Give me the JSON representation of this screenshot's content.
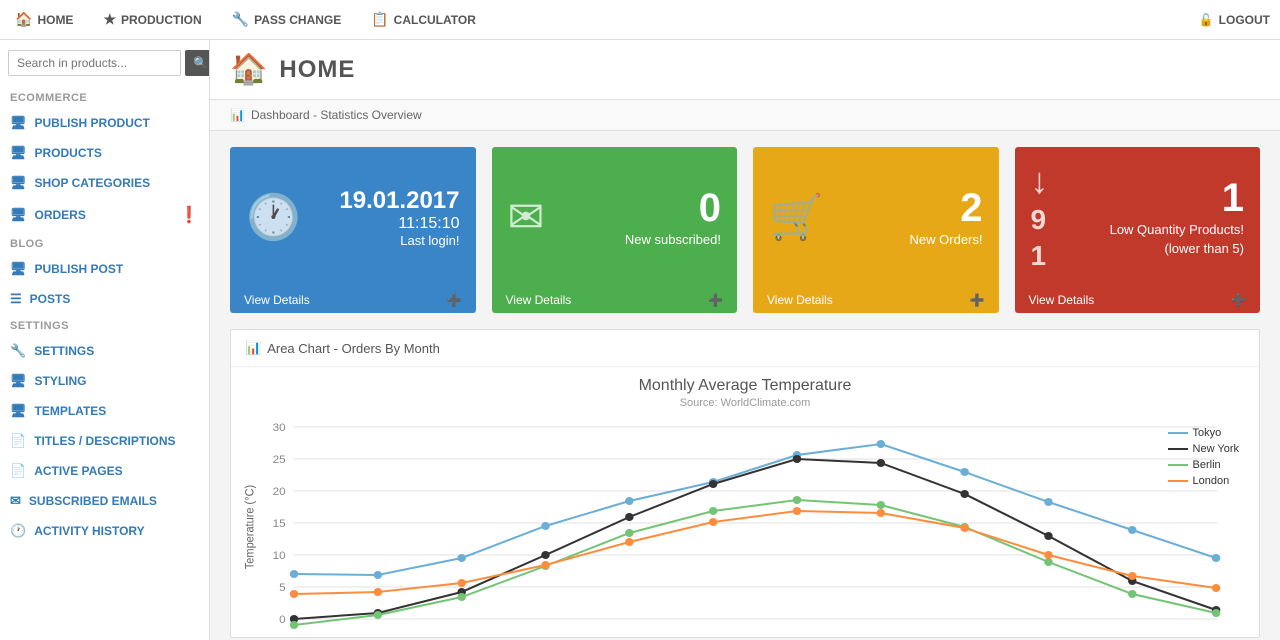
{
  "topnav": {
    "items": [
      {
        "label": "HOME",
        "icon": "🏠",
        "name": "home"
      },
      {
        "label": "PRODUCTION",
        "icon": "★",
        "name": "production"
      },
      {
        "label": "PASS CHANGE",
        "icon": "🔧",
        "name": "pass-change"
      },
      {
        "label": "CALCULATOR",
        "icon": "📋",
        "name": "calculator"
      }
    ],
    "logout_label": "LOGOUT",
    "logout_icon": "🔓"
  },
  "sidebar": {
    "search_placeholder": "Search in products...",
    "sections": [
      {
        "label": "ECOMMERCE",
        "items": [
          {
            "label": "PUBLISH PRODUCT",
            "icon": "🖥",
            "name": "publish-product",
            "alert": false
          },
          {
            "label": "PRODUCTS",
            "icon": "🖥",
            "name": "products",
            "alert": false
          },
          {
            "label": "SHOP CATEGORIES",
            "icon": "🖥",
            "name": "shop-categories",
            "alert": false
          },
          {
            "label": "ORDERS",
            "icon": "🖥",
            "name": "orders",
            "alert": true
          }
        ]
      },
      {
        "label": "BLOG",
        "items": [
          {
            "label": "PUBLISH POST",
            "icon": "🖥",
            "name": "publish-post",
            "alert": false
          },
          {
            "label": "POSTS",
            "icon": "☰",
            "name": "posts",
            "alert": false
          }
        ]
      },
      {
        "label": "SETTINGS",
        "items": [
          {
            "label": "SETTINGS",
            "icon": "🔧",
            "name": "settings",
            "alert": false
          },
          {
            "label": "STYLING",
            "icon": "🖥",
            "name": "styling",
            "alert": false
          },
          {
            "label": "TEMPLATES",
            "icon": "🖥",
            "name": "templates",
            "alert": false
          },
          {
            "label": "TITLES / DESCRIPTIONS",
            "icon": "📄",
            "name": "titles-descriptions",
            "alert": false
          },
          {
            "label": "ACTIVE PAGES",
            "icon": "📄",
            "name": "active-pages",
            "alert": false
          },
          {
            "label": "SUBSCRIBED EMAILS",
            "icon": "✉",
            "name": "subscribed-emails",
            "alert": false
          },
          {
            "label": "ACTIVITY HISTORY",
            "icon": "🕐",
            "name": "activity-history",
            "alert": false
          }
        ]
      }
    ]
  },
  "main": {
    "title": "HOME",
    "breadcrumb": "Dashboard - Statistics Overview",
    "stats": [
      {
        "type": "datetime",
        "color": "card-blue",
        "date": "19.01.2017",
        "time": "11:15:10",
        "sublabel": "Last login!",
        "footer_label": "View Details",
        "icon": "🕐"
      },
      {
        "type": "number",
        "color": "card-green",
        "number": "0",
        "label": "New subscribed!",
        "footer_label": "View Details",
        "icon": "✉"
      },
      {
        "type": "number",
        "color": "card-orange",
        "number": "2",
        "label": "New Orders!",
        "footer_label": "View Details",
        "icon": "🛒"
      },
      {
        "type": "low-qty",
        "color": "card-red",
        "number": "1",
        "label": "Low Quantity Products!",
        "sublabel": "(lower than 5)",
        "footer_label": "View Details",
        "icon": "↓91"
      }
    ],
    "chart": {
      "header": "Area Chart - Orders By Month",
      "title": "Monthly Average Temperature",
      "subtitle": "Source: WorldClimate.com",
      "y_label": "Temperature (°C)",
      "y_axis": [
        0,
        5,
        10,
        15,
        20,
        25,
        30
      ],
      "series": [
        {
          "name": "Tokyo",
          "color": "#6baed6",
          "data": [
            7,
            6.9,
            9.5,
            14.5,
            18.4,
            21.5,
            25.2,
            26.5,
            23.3,
            18.3,
            13.9,
            9.6
          ]
        },
        {
          "name": "New York",
          "color": "#2b2b2b",
          "data": [
            0,
            1,
            4.2,
            10.1,
            16,
            21,
            24.9,
            24.3,
            19.5,
            13,
            6,
            1.3
          ]
        },
        {
          "name": "Berlin",
          "color": "#74c476",
          "data": [
            -0.9,
            0.6,
            3.5,
            8.4,
            13.5,
            17,
            18.6,
            17.9,
            14.3,
            9,
            3.9,
            1
          ]
        },
        {
          "name": "London",
          "color": "#fd8d3c",
          "data": [
            3.9,
            4.2,
            5.7,
            8.5,
            11.9,
            15.2,
            17,
            16.6,
            14.2,
            10.3,
            6.6,
            4.8
          ]
        }
      ]
    }
  }
}
